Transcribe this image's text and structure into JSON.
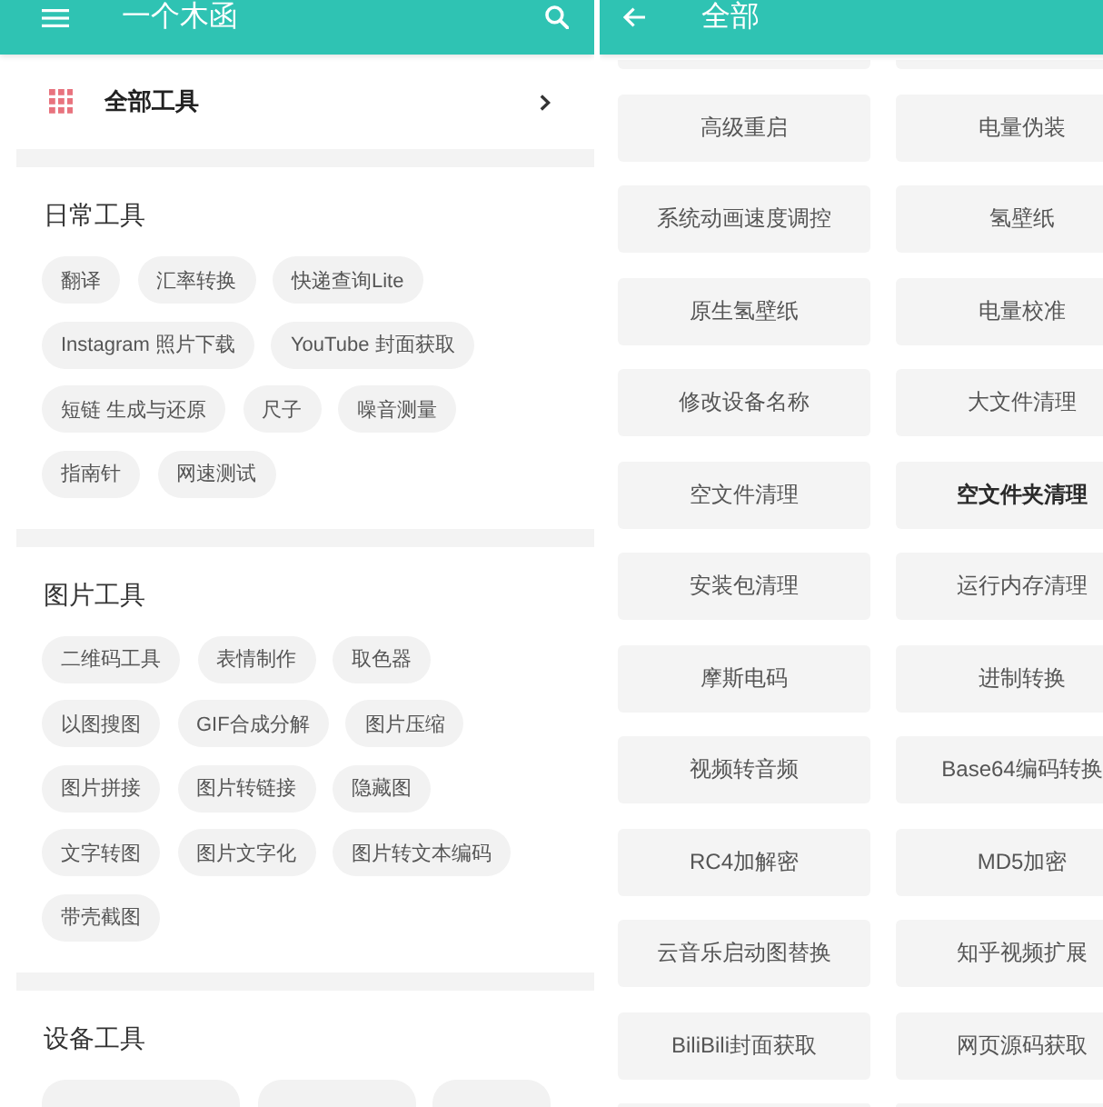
{
  "left_screen": {
    "app_bar": {
      "title": "一个木函"
    },
    "all_tools": {
      "label": "全部工具"
    },
    "sections": [
      {
        "title": "日常工具",
        "tools": [
          "翻译",
          "汇率转换",
          "快递查询Lite",
          "Instagram 照片下载",
          "YouTube 封面获取",
          "短链 生成与还原",
          "尺子",
          "噪音测量",
          "指南针",
          "网速测试"
        ]
      },
      {
        "title": "图片工具",
        "tools": [
          "二维码工具",
          "表情制作",
          "取色器",
          "以图搜图",
          "GIF合成分解",
          "图片压缩",
          "图片拼接",
          "图片转链接",
          "隐藏图",
          "文字转图",
          "图片文字化",
          "图片转文本编码",
          "带壳截图"
        ]
      },
      {
        "title": "设备工具"
      }
    ]
  },
  "right_screen": {
    "app_bar": {
      "title": "全部"
    },
    "tools": [
      {
        "label": "高级重启",
        "emphasized": false
      },
      {
        "label": "电量伪装",
        "emphasized": false
      },
      {
        "label": "系统动画速度调控",
        "emphasized": false
      },
      {
        "label": "氢壁纸",
        "emphasized": false
      },
      {
        "label": "原生氢壁纸",
        "emphasized": false
      },
      {
        "label": "电量校准",
        "emphasized": false
      },
      {
        "label": "修改设备名称",
        "emphasized": false
      },
      {
        "label": "大文件清理",
        "emphasized": false
      },
      {
        "label": "空文件清理",
        "emphasized": false
      },
      {
        "label": "空文件夹清理",
        "emphasized": true
      },
      {
        "label": "安装包清理",
        "emphasized": false
      },
      {
        "label": "运行内存清理",
        "emphasized": false
      },
      {
        "label": "摩斯电码",
        "emphasized": false
      },
      {
        "label": "进制转换",
        "emphasized": false
      },
      {
        "label": "视频转音频",
        "emphasized": false
      },
      {
        "label": "Base64编码转换",
        "emphasized": false
      },
      {
        "label": "RC4加解密",
        "emphasized": false
      },
      {
        "label": "MD5加密",
        "emphasized": false
      },
      {
        "label": "云音乐启动图替换",
        "emphasized": false
      },
      {
        "label": "知乎视频扩展",
        "emphasized": false
      },
      {
        "label": "BiliBili封面获取",
        "emphasized": false
      },
      {
        "label": "网页源码获取",
        "emphasized": false
      }
    ]
  }
}
